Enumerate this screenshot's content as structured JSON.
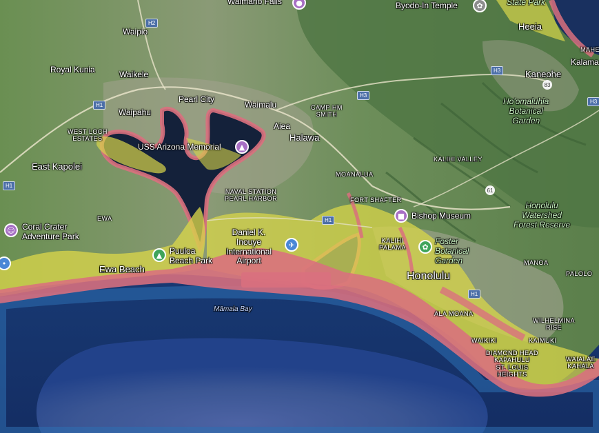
{
  "map": {
    "places": {
      "royal_kunia": "Royal Kunia",
      "waipio": "Waipio",
      "waikele": "Waikele",
      "waipahu": "Waipahu",
      "west_loch_estates": "WEST LOCH\nESTATES",
      "east_kapolei": "East Kapolei",
      "ewa": "EWA",
      "ewa_beach": "Ewa Beach",
      "pearl_city": "Pearl City",
      "waimalu": "Waimalu",
      "aiea": "Aiea",
      "halawa": "Halawa",
      "camp_hm_smith": "CAMP HM\nSMITH",
      "moanalua": "MOANALUA",
      "naval_station": "NAVAL STATION\nPEARL HARBOR",
      "fort_shafter": "FORT SHAFTER",
      "kalihi_valley": "KALIHI VALLEY",
      "kalihi_palama": "KALIHI\nPALAMA",
      "honolulu": "Honolulu",
      "alakea": "ALA MOANA",
      "waikiki": "WAIKIKI",
      "diamond_head": "DIAMOND HEAD\nKAPAHULU\nST. LOUIS\nHEIGHTS",
      "kaimuki": "KAIMUKI",
      "manoa": "MANOA",
      "palolo": "PALOLO",
      "wilhelmina_rise": "WILHELMINA\nRISE",
      "waialae_kahala": "WAIALAE\nKAHALA",
      "heeia": "Heeia",
      "kaneohe": "Kaneohe",
      "mahe": "MAHE",
      "kalama": "Kalama",
      "state_park": "State Park"
    },
    "pois": {
      "waimano_falls": "Waimano Falls",
      "byodo_in": "Byodo-In Temple",
      "uss_arizona": "USS Arizona Memorial",
      "coral_crater": "Coral Crater\nAdventure Park",
      "puuloa": "Puuloa\nBeach Park",
      "airport": "Daniel K.\nInouye\nInternational\nAirport",
      "bishop_museum": "Bishop Museum",
      "foster_garden": "Foster\nBotanical\nGarden",
      "hoomaluhia": "Ho'omaluhia\nBotanical\nGarden",
      "watershed": "Honolulu\nWatershed\nForest Reserve"
    },
    "water": {
      "mamala_bay": "Māmala Bay"
    },
    "highways": {
      "h1_west": "H1",
      "h1_waipahu": "H1",
      "h1_airport": "H1",
      "h1_honolulu": "H1",
      "h2": "H2",
      "h3": "H3",
      "h3_east": "H3",
      "h3_kaneohe": "H3",
      "r61": "61",
      "r83": "83"
    }
  }
}
